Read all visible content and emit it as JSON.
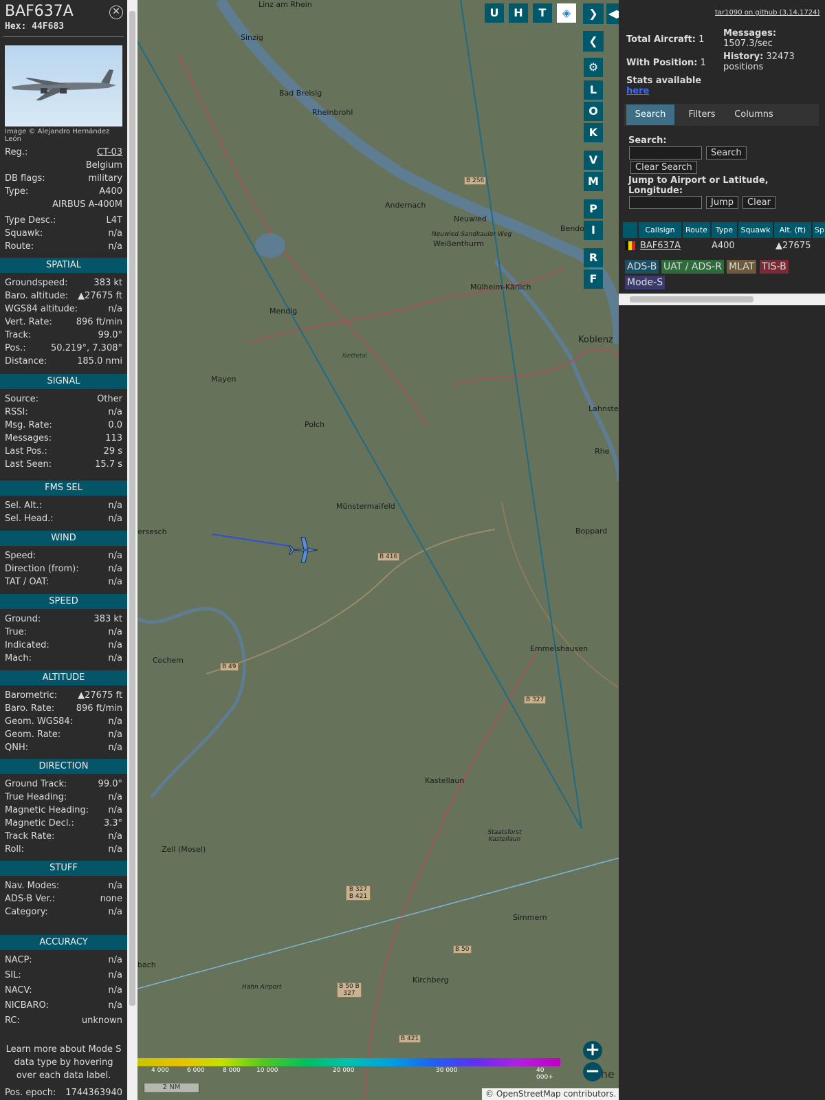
{
  "info": {
    "callsign": "BAF637A",
    "hex_label": "Hex:",
    "hex": "44F683",
    "image_credit": "Image © Alejandro Hernández León",
    "reg_label": "Reg.:",
    "reg": "CT-03",
    "country": "Belgium",
    "dbflags_label": "DB flags:",
    "dbflags": "military",
    "type_label": "Type:",
    "type": "A400",
    "type_full": "AIRBUS A-400M",
    "typedesc_label": "Type Desc.:",
    "typedesc": "L4T",
    "squawk_label": "Squawk:",
    "squawk": "n/a",
    "route_label": "Route:",
    "route": "n/a",
    "sections": {
      "spatial": "SPATIAL",
      "signal": "SIGNAL",
      "fms": "FMS SEL",
      "wind": "WIND",
      "speed": "SPEED",
      "altitude": "ALTITUDE",
      "direction": "DIRECTION",
      "stuff": "STUFF",
      "accuracy": "ACCURACY"
    },
    "spatial": [
      {
        "k": "Groundspeed:",
        "v": "383 kt"
      },
      {
        "k": "Baro. altitude:",
        "v": "▲27675 ft"
      },
      {
        "k": "WGS84 altitude:",
        "v": "n/a"
      },
      {
        "k": "Vert. Rate:",
        "v": "896 ft/min"
      },
      {
        "k": "Track:",
        "v": "99.0°"
      },
      {
        "k": "Pos.:",
        "v": "50.219°, 7.308°"
      },
      {
        "k": "Distance:",
        "v": "185.0 nmi"
      }
    ],
    "signal": [
      {
        "k": "Source:",
        "v": "Other"
      },
      {
        "k": "RSSI:",
        "v": "n/a"
      },
      {
        "k": "Msg. Rate:",
        "v": "0.0"
      },
      {
        "k": "Messages:",
        "v": "113"
      },
      {
        "k": "Last Pos.:",
        "v": "29 s"
      },
      {
        "k": "Last Seen:",
        "v": "15.7 s"
      }
    ],
    "fms": [
      {
        "k": "Sel. Alt.:",
        "v": "n/a"
      },
      {
        "k": "Sel. Head.:",
        "v": "n/a"
      }
    ],
    "wind": [
      {
        "k": "Speed:",
        "v": "n/a"
      },
      {
        "k": "Direction (from):",
        "v": "n/a"
      },
      {
        "k": "TAT / OAT:",
        "v": "n/a"
      }
    ],
    "speed": [
      {
        "k": "Ground:",
        "v": "383 kt"
      },
      {
        "k": "True:",
        "v": "n/a"
      },
      {
        "k": "Indicated:",
        "v": "n/a"
      },
      {
        "k": "Mach:",
        "v": "n/a"
      }
    ],
    "altitude": [
      {
        "k": "Barometric:",
        "v": "▲27675 ft"
      },
      {
        "k": "Baro. Rate:",
        "v": "896 ft/min"
      },
      {
        "k": "Geom. WGS84:",
        "v": "n/a"
      },
      {
        "k": "Geom. Rate:",
        "v": "n/a"
      },
      {
        "k": "QNH:",
        "v": "n/a"
      }
    ],
    "direction": [
      {
        "k": "Ground Track:",
        "v": "99.0°"
      },
      {
        "k": "True Heading:",
        "v": "n/a"
      },
      {
        "k": "Magnetic Heading:",
        "v": "n/a"
      },
      {
        "k": "Magnetic Decl.:",
        "v": "3.3°"
      },
      {
        "k": "Track Rate:",
        "v": "n/a"
      },
      {
        "k": "Roll:",
        "v": "n/a"
      }
    ],
    "stuff": [
      {
        "k": "Nav. Modes:",
        "v": "n/a"
      },
      {
        "k": "ADS-B Ver.:",
        "v": "none"
      },
      {
        "k": "Category:",
        "v": "n/a"
      }
    ],
    "accuracy": [
      {
        "k": "NACP:",
        "v": "n/a"
      },
      {
        "k": "SIL:",
        "v": "n/a"
      },
      {
        "k": "NACV:",
        "v": "n/a"
      },
      {
        "k": "NICBARO:",
        "v": "n/a"
      },
      {
        "k": "RC:",
        "v": "unknown"
      }
    ],
    "note": "Learn more about Mode S data type by hovering over each data label.",
    "epoch_label": "Pos. epoch:",
    "epoch": "1744363940"
  },
  "map": {
    "controls_top": [
      "U",
      "H",
      "T"
    ],
    "controls_side": [
      "L",
      "O",
      "K",
      "V",
      "M",
      "P",
      "I",
      "R",
      "F"
    ],
    "places": [
      "Linz am Rhein",
      "Sinzig",
      "Bad Breisig",
      "Rheinbrohl",
      "Andernach",
      "Neuwied",
      "Bendorf",
      "Weißenthurm",
      "Mülheim-Kärlich",
      "Mendig",
      "Koblenz",
      "Mayen",
      "Polch",
      "Lahnstein",
      "Münstermaifeld",
      "Boppard",
      "Cochem",
      "Emmelshausen",
      "Kastellaun",
      "Zell (Mosel)",
      "Simmern",
      "Kirchberg",
      "Hahn Airport",
      "Nettetal",
      "Neuwied-Sandkauler Weg",
      "Staatsforst Kastellaun",
      "Rhe",
      "ersesch",
      "bach",
      "Nahe"
    ],
    "roads": [
      "B 256",
      "B 416",
      "B 49",
      "B 327",
      "B 327 B 421",
      "B 50",
      "B 50 B 327",
      "B 421"
    ],
    "scale_ticks": [
      "4 000",
      "6 000",
      "8 000",
      "10 000",
      "20 000",
      "30 000",
      "40 000+"
    ],
    "scale_label": "2 NM",
    "attribution": "© OpenStreetMap contributors."
  },
  "panel": {
    "github": "tar1090 on github (3.14.1724)",
    "total_label": "Total Aircraft:",
    "total": "1",
    "messages_label": "Messages:",
    "messages": "1507.3/sec",
    "withpos_label": "With Position:",
    "withpos": "1",
    "history_label": "History:",
    "history": "32473 positions",
    "stats_text": "Stats available",
    "stats_link": "here",
    "tabs": [
      "Search",
      "Filters",
      "Columns"
    ],
    "search_label": "Search:",
    "search_button": "Search",
    "clear_search": "Clear Search",
    "jump_label": "Jump to Airport or Latitude, Longitude:",
    "jump_button": "Jump",
    "clear_button": "Clear",
    "columns": [
      "Callsign",
      "Route",
      "Type",
      "Squawk",
      "Alt. (ft)",
      "Sp"
    ],
    "row": {
      "callsign": "BAF637A",
      "route": "",
      "type": "A400",
      "squawk": "",
      "alt": "▲27675"
    },
    "legend": [
      {
        "label": "ADS-B",
        "bg": "#1c4f66"
      },
      {
        "label": "UAT / ADS-R",
        "bg": "#2e6a3c"
      },
      {
        "label": "MLAT",
        "bg": "#6d5a3a"
      },
      {
        "label": "TIS-B",
        "bg": "#7a2a35"
      },
      {
        "label": "Mode-S",
        "bg": "#3b3a6e"
      }
    ]
  }
}
